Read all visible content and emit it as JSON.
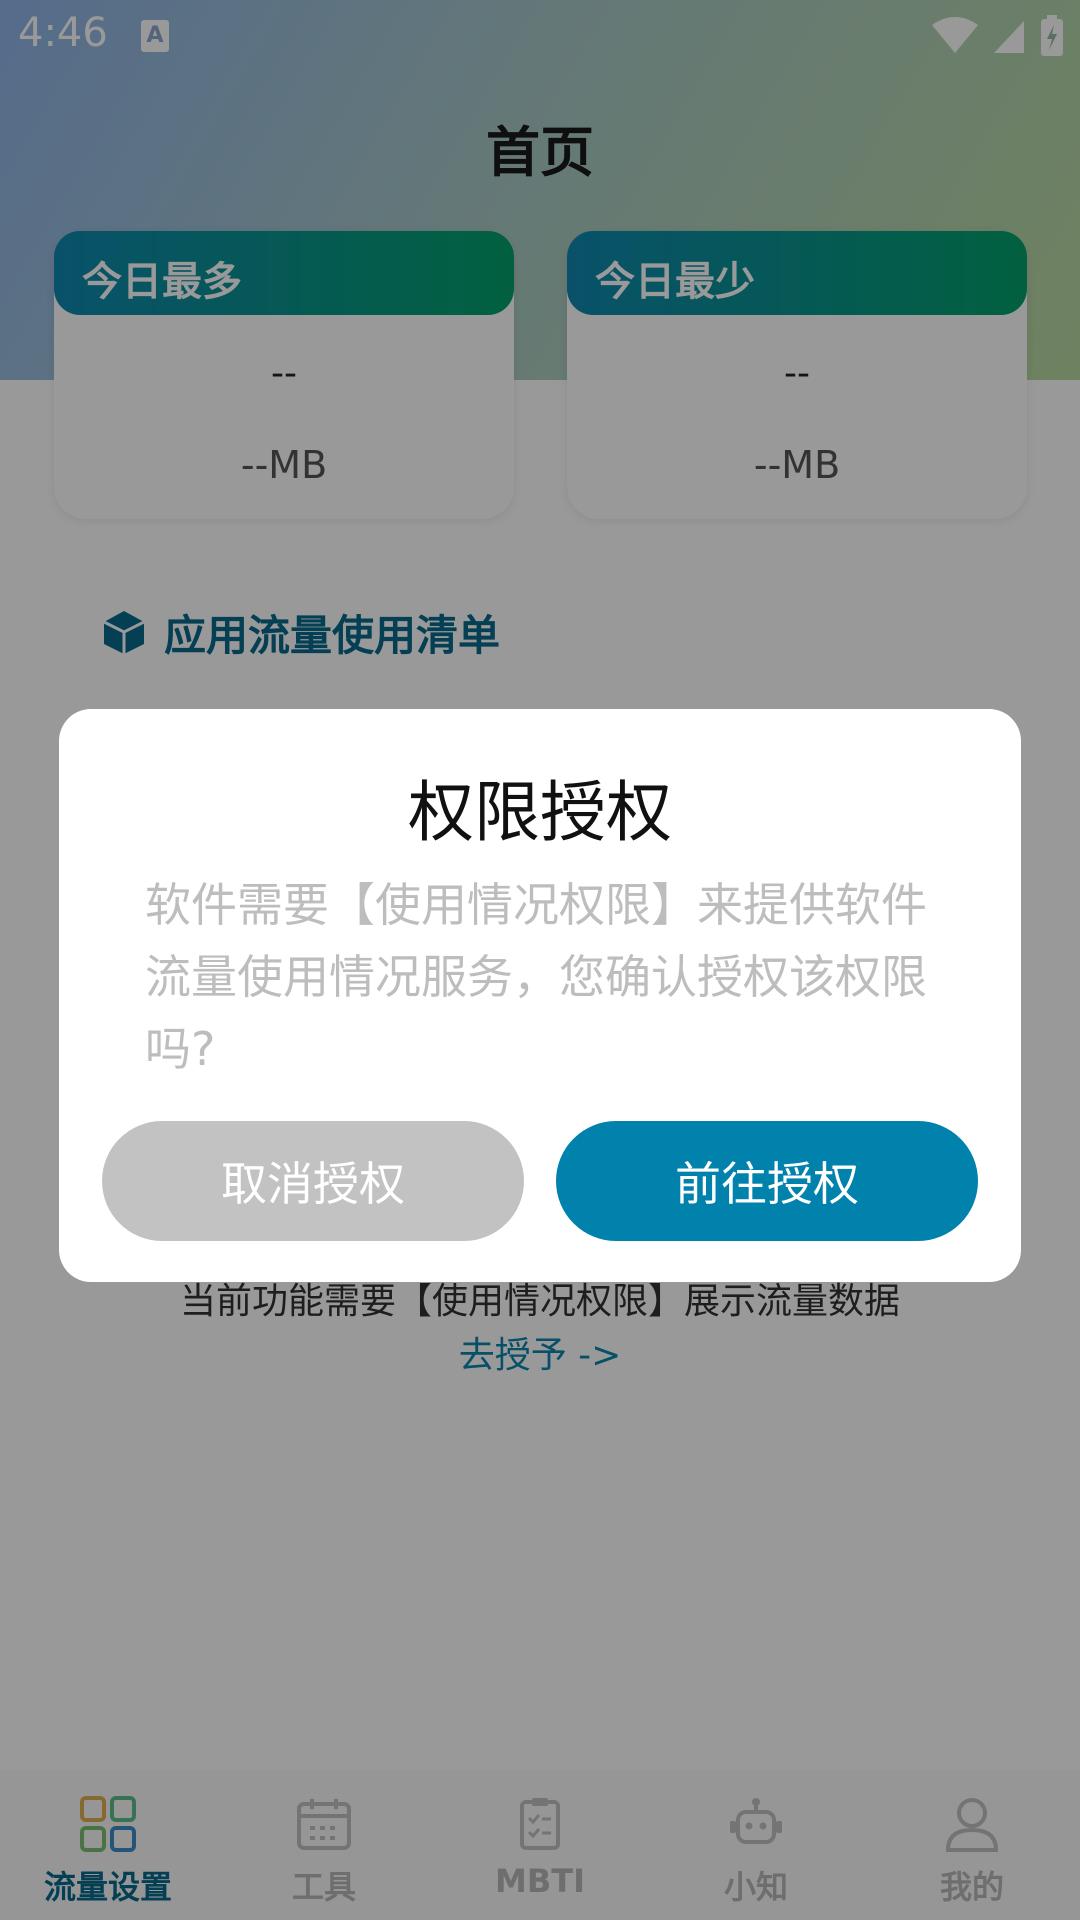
{
  "status_bar": {
    "time": "4:46"
  },
  "header": {
    "title": "首页"
  },
  "stats": [
    {
      "title": "今日最多",
      "app_name": "--",
      "value": "--MB"
    },
    {
      "title": "今日最少",
      "app_name": "--",
      "value": "--MB"
    }
  ],
  "list": {
    "title": "应用流量使用清单",
    "permission_message": "当前功能需要【使用情况权限】展示流量数据",
    "grant_link": "去授予 ->"
  },
  "dialog": {
    "title": "权限授权",
    "message": "软件需要【使用情况权限】来提供软件流量使用情况服务，您确认授权该权限吗?",
    "cancel_label": "取消授权",
    "confirm_label": "前往授权"
  },
  "tabs": [
    {
      "label": "流量设置",
      "icon": "grid-icon",
      "active": true
    },
    {
      "label": "工具",
      "icon": "calendar-icon",
      "active": false
    },
    {
      "label": "MBTI",
      "icon": "clipboard-icon",
      "active": false
    },
    {
      "label": "小知",
      "icon": "robot-icon",
      "active": false
    },
    {
      "label": "我的",
      "icon": "person-icon",
      "active": false
    }
  ],
  "colors": {
    "accent": "#0082ad",
    "header_gradient_start": "#0f88b1",
    "header_gradient_end": "#04a16b",
    "cancel_button": "#c2c2c2"
  }
}
